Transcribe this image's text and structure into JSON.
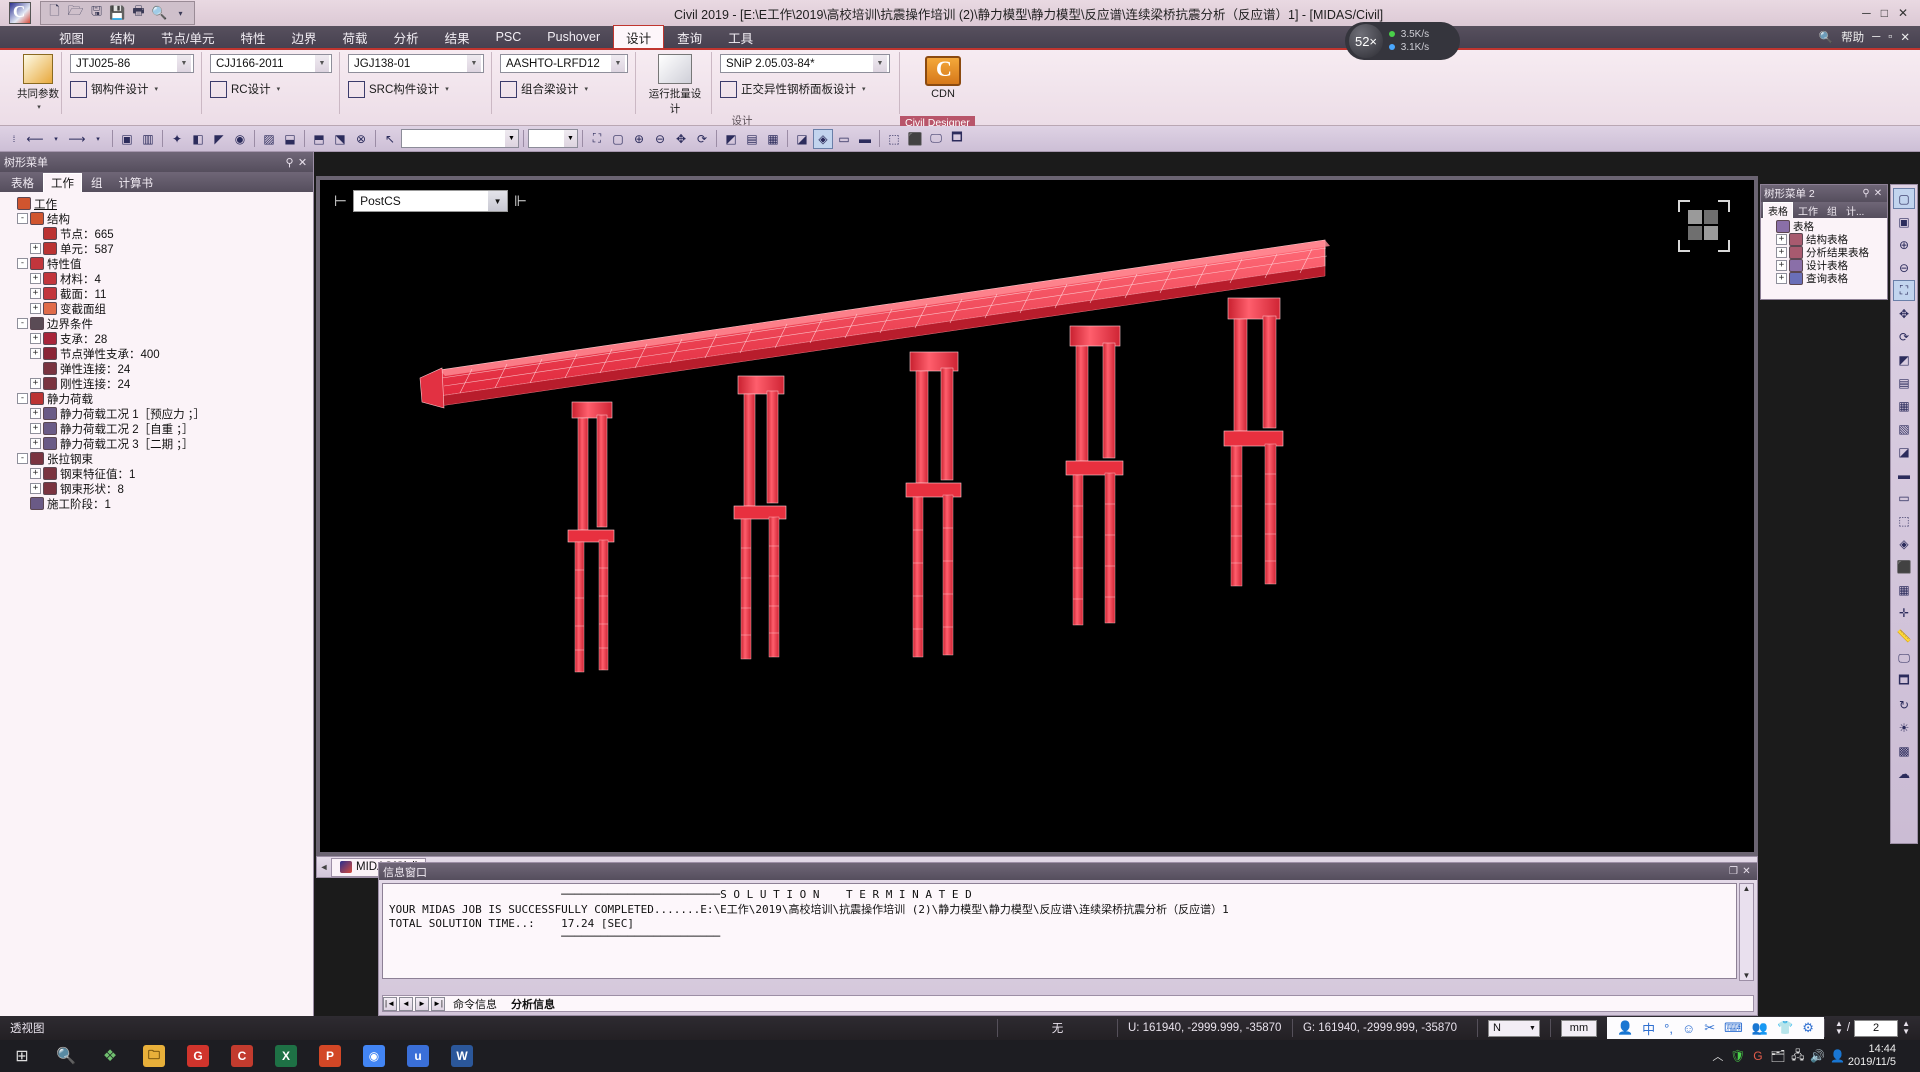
{
  "titlebar": {
    "title": "Civil 2019 - [E:\\E工作\\2019\\高校培训\\抗震操作培训 (2)\\静力模型\\静力模型\\反应谱\\连续梁桥抗震分析（反应谱）1] - [MIDAS/Civil]",
    "quick_access": [
      "new-icon",
      "open-icon",
      "save-as-icon",
      "save-icon",
      "print-icon",
      "preview-icon",
      "more-icon"
    ],
    "window_buttons": [
      "minimize",
      "maximize",
      "close"
    ]
  },
  "menubar": {
    "items": [
      {
        "label": "视图",
        "active": false
      },
      {
        "label": "结构",
        "active": false
      },
      {
        "label": "节点/单元",
        "active": false
      },
      {
        "label": "特性",
        "active": false
      },
      {
        "label": "边界",
        "active": false
      },
      {
        "label": "荷载",
        "active": false
      },
      {
        "label": "分析",
        "active": false
      },
      {
        "label": "结果",
        "active": false
      },
      {
        "label": "PSC",
        "active": false
      },
      {
        "label": "Pushover",
        "active": false
      },
      {
        "label": "设计",
        "active": true
      },
      {
        "label": "查询",
        "active": false
      },
      {
        "label": "工具",
        "active": false
      }
    ],
    "help_label": "帮助"
  },
  "ribbon": {
    "tab_label": "设计",
    "groups": [
      {
        "name": "common-params",
        "big_label": "共同参数"
      },
      {
        "name": "steel-design",
        "combo": "JTJ025-86",
        "button": "钢构件设计"
      },
      {
        "name": "rc-design",
        "combo": "CJJ166-2011",
        "button": "RC设计"
      },
      {
        "name": "src-design",
        "combo": "JGJ138-01",
        "button": "SRC构件设计"
      },
      {
        "name": "composite-design",
        "combo": "AASHTO-LRFD12",
        "button": "组合梁设计"
      },
      {
        "name": "batch-design",
        "big_label": "运行批量设计"
      },
      {
        "name": "orthotropic-design",
        "combo": "SNiP 2.05.03-84*",
        "button": "正交异性钢桥面板设计"
      }
    ],
    "group_caption": "设计",
    "cdn": {
      "title": "CDN",
      "label": "Civil Designer"
    }
  },
  "viewbar": {
    "stage_combo": "",
    "icons": [
      "undo-icon",
      "redo-icon",
      "select-window-icon",
      "select-poly-icon",
      "select-identity-icon",
      "select-intersect-icon",
      "select-previous-icon",
      "select-all-icon",
      "select-plane-icon",
      "select-volume-icon",
      "unselect-window-icon",
      "unselect-poly-icon",
      "unselect-all-icon",
      "pick-icon",
      "zoom-window-icon",
      "zoom-previous-icon",
      "zoom-all-icon",
      "zoom-in-icon",
      "zoom-out-icon",
      "pan-icon",
      "rotate-icon",
      "render-icon",
      "wireframe-icon",
      "hidden-icon"
    ]
  },
  "left_panel": {
    "title": "树形菜单",
    "tabs": [
      {
        "label": "表格",
        "active": false
      },
      {
        "label": "工作",
        "active": true
      },
      {
        "label": "组",
        "active": false
      },
      {
        "label": "计算书",
        "active": false
      }
    ],
    "tree": [
      {
        "indent": 0,
        "exp": "",
        "icon": "work-icon",
        "label": "工作",
        "underline": true
      },
      {
        "indent": 1,
        "exp": "-",
        "icon": "structure-icon",
        "label": "结构"
      },
      {
        "indent": 2,
        "exp": "",
        "icon": "node-icon",
        "label": "节点：665"
      },
      {
        "indent": 2,
        "exp": "+",
        "icon": "element-icon",
        "label": "单元：587"
      },
      {
        "indent": 1,
        "exp": "-",
        "icon": "property-icon",
        "label": "特性值"
      },
      {
        "indent": 2,
        "exp": "+",
        "icon": "material-icon",
        "label": "材料：4"
      },
      {
        "indent": 2,
        "exp": "+",
        "icon": "section-icon",
        "label": "截面：11"
      },
      {
        "indent": 2,
        "exp": "+",
        "icon": "taper-group-icon",
        "label": "变截面组"
      },
      {
        "indent": 1,
        "exp": "-",
        "icon": "boundary-icon",
        "label": "边界条件"
      },
      {
        "indent": 2,
        "exp": "+",
        "icon": "support-icon",
        "label": "支承：28"
      },
      {
        "indent": 2,
        "exp": "+",
        "icon": "spring-icon",
        "label": "节点弹性支承：400"
      },
      {
        "indent": 2,
        "exp": "",
        "icon": "elastic-link-icon",
        "label": "弹性连接：24"
      },
      {
        "indent": 2,
        "exp": "+",
        "icon": "rigid-link-icon",
        "label": "刚性连接：24"
      },
      {
        "indent": 1,
        "exp": "-",
        "icon": "static-load-icon",
        "label": "静力荷载"
      },
      {
        "indent": 2,
        "exp": "+",
        "icon": "load-case-icon",
        "label": "静力荷载工况 1［预应力 ；］"
      },
      {
        "indent": 2,
        "exp": "+",
        "icon": "load-case-icon",
        "label": "静力荷载工况 2［自重 ；］"
      },
      {
        "indent": 2,
        "exp": "+",
        "icon": "load-case-icon",
        "label": "静力荷载工况 3［二期 ；］"
      },
      {
        "indent": 1,
        "exp": "-",
        "icon": "tendon-icon",
        "label": "张拉钢束"
      },
      {
        "indent": 2,
        "exp": "+",
        "icon": "tendon-prop-icon",
        "label": "钢束特征值：1"
      },
      {
        "indent": 2,
        "exp": "+",
        "icon": "tendon-shape-icon",
        "label": "钢束形状：8"
      },
      {
        "indent": 1,
        "exp": "",
        "icon": "stage-icon",
        "label": "施工阶段：1"
      }
    ]
  },
  "model_view": {
    "stage_selector": "PostCS",
    "stage_icon": "construction-stage-icon",
    "next_stage_icon": "next-stage-icon",
    "background_color": "#000000",
    "model_color": "#f2485b",
    "tab": {
      "label": "MIDAS/Civil",
      "icon": "midas-icon"
    },
    "scroll_left": "◄",
    "scroll_right": "►"
  },
  "right_panel": {
    "title": "树形菜单 2",
    "tabs": [
      {
        "label": "表格",
        "active": true
      },
      {
        "label": "工作",
        "active": false
      },
      {
        "label": "组",
        "active": false
      },
      {
        "label": "计...",
        "active": false
      }
    ],
    "tree": [
      {
        "indent": 0,
        "exp": "",
        "icon": "table-icon",
        "label": "表格"
      },
      {
        "indent": 1,
        "exp": "+",
        "icon": "struct-table-icon",
        "label": "结构表格"
      },
      {
        "indent": 1,
        "exp": "+",
        "icon": "result-table-icon",
        "label": "分析结果表格"
      },
      {
        "indent": 1,
        "exp": "+",
        "icon": "design-table-icon",
        "label": "设计表格"
      },
      {
        "indent": 1,
        "exp": "+",
        "icon": "query-table-icon",
        "label": "查询表格"
      }
    ]
  },
  "right_rail": {
    "icons": [
      "zoom-window-icon",
      "zoom-previous-icon",
      "zoom-in-icon",
      "zoom-out-icon",
      "zoom-fit-icon",
      "pan-icon",
      "rotate-icon",
      "iso-view-icon",
      "top-view-icon",
      "front-view-icon",
      "right-view-icon",
      "render-icon",
      "hidden-icon",
      "wire-icon",
      "shrink-icon",
      "perspective-icon",
      "display-icon",
      "grid-icon",
      "snap-icon",
      "measure-icon",
      "capture-icon",
      "redraw-icon",
      "refresh-icon",
      "light-icon",
      "texture-icon",
      "fog-icon"
    ]
  },
  "message_window": {
    "title": "信息窗口",
    "buttons": [
      "maximize",
      "close"
    ],
    "lines": [
      "                          ────────────────────────S O L U T I O N    T E R M I N A T E D",
      "YOUR MIDAS JOB IS SUCCESSFULLY COMPLETED.......E:\\E工作\\2019\\高校培训\\抗震操作培训 (2)\\静力模型\\静力模型\\反应谱\\连续梁桥抗震分析（反应谱）1",
      "TOTAL SOLUTION TIME..:    17.24 [SEC]",
      "                          ────────────────────────"
    ],
    "tabs": [
      {
        "label": "命令信息",
        "active": false
      },
      {
        "label": "分析信息",
        "active": true
      }
    ],
    "nav_buttons": [
      "|◄",
      "◄",
      "►",
      "►|"
    ]
  },
  "status_bar": {
    "view_mode": "透视图",
    "snap": "无",
    "ucs": "U: 161940, -2999.999, -35870",
    "gcs": "G: 161940, -2999.999, -35870",
    "unit_force": "N",
    "unit_length": "mm",
    "tray_icons": [
      "user-icon",
      "ime-cn-icon",
      "ime-punct-icon",
      "emoji-icon",
      "scissors-icon",
      "keyboard-icon",
      "contact-icon",
      "shirt-icon",
      "gear-icon"
    ],
    "page_sep": "/",
    "page_value": "2"
  },
  "network_overlay": {
    "speed_label": "52×",
    "down_speed": "3.5K/s",
    "up_speed": "3.1K/s"
  },
  "taskbar": {
    "start_icon": "windows-icon",
    "search_icon": "search-icon",
    "apps": [
      {
        "name": "task-view",
        "letter": "❖",
        "color": "#2e8b57"
      },
      {
        "name": "file-explorer",
        "letter": "📁",
        "color": "#e8b03a"
      },
      {
        "name": "app-g",
        "letter": "G",
        "color": "#d0342c"
      },
      {
        "name": "midas-civil",
        "letter": "C",
        "color": "#c23b2e"
      },
      {
        "name": "excel",
        "letter": "X",
        "color": "#1e7145"
      },
      {
        "name": "powerpoint",
        "letter": "P",
        "color": "#d24726"
      },
      {
        "name": "chrome",
        "letter": "◉",
        "color": "#4285f4"
      },
      {
        "name": "uvw",
        "letter": "u",
        "color": "#3a6fd8"
      },
      {
        "name": "word",
        "letter": "W",
        "color": "#2b579a"
      }
    ],
    "clock_time": "14:44",
    "clock_date": "2019/11/5",
    "tray": [
      "chevron-up-icon",
      "shield-icon",
      "network-icon",
      "battery-icon",
      "volume-icon",
      "notification-icon"
    ]
  }
}
